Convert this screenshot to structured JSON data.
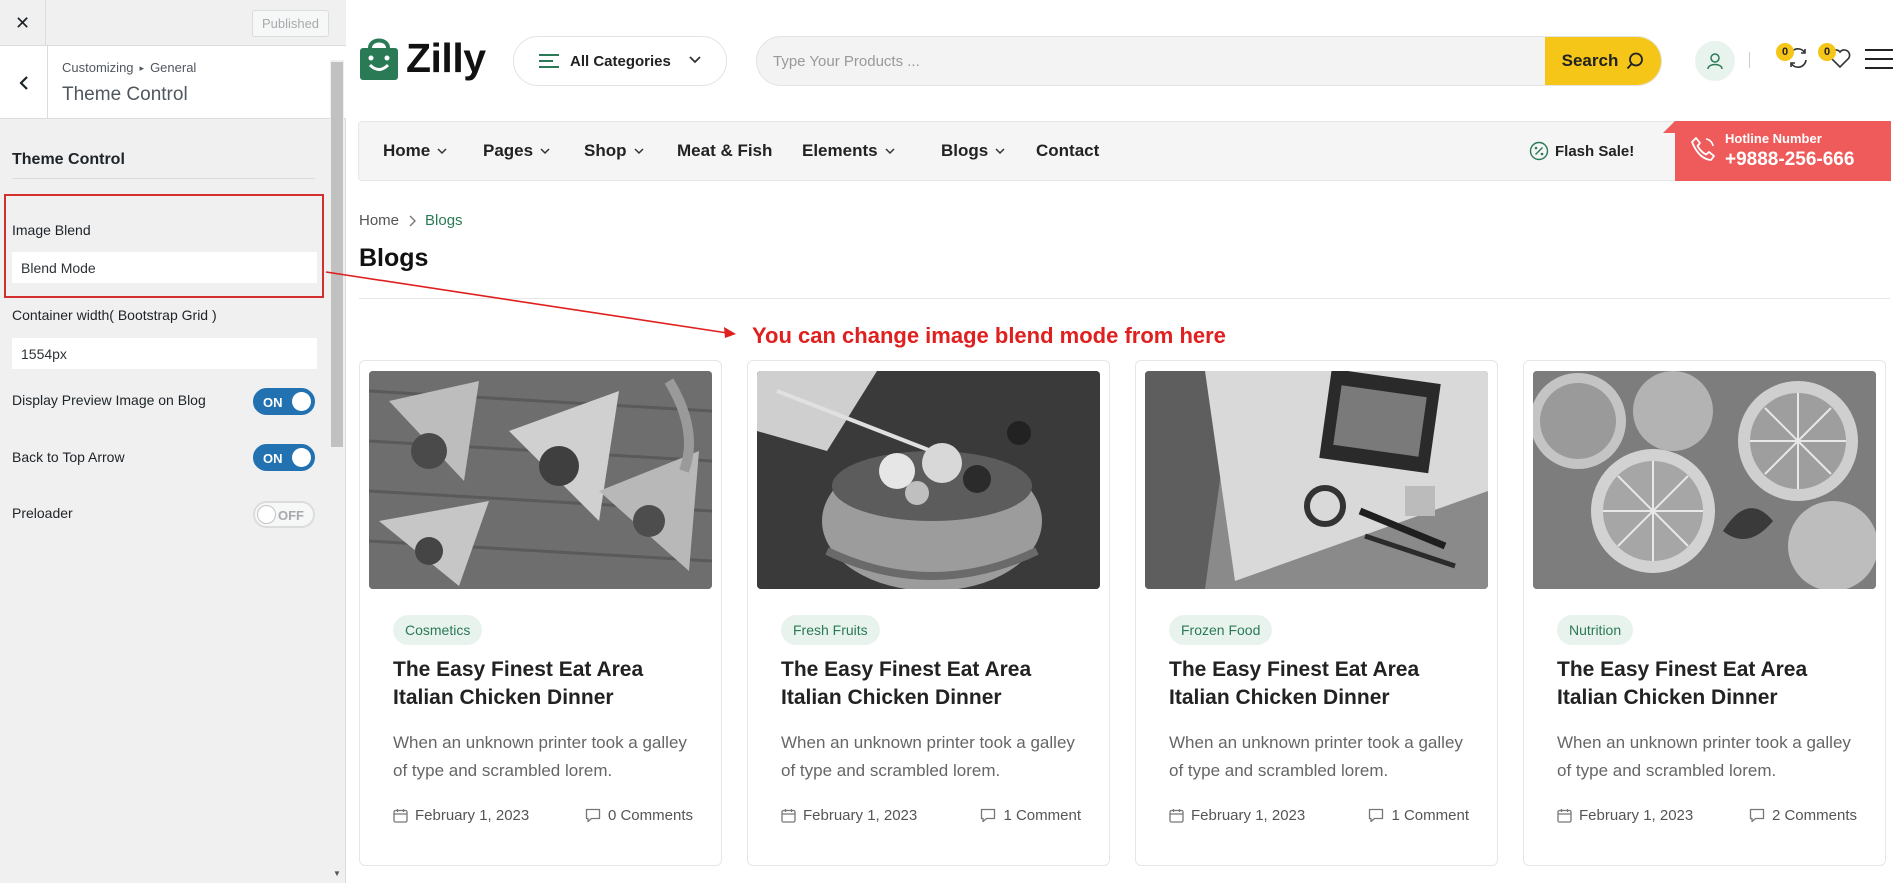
{
  "customizer": {
    "close_icon": "close-icon",
    "published_label": "Published",
    "breadcrumb": [
      "Customizing",
      "General"
    ],
    "panel_title": "Theme Control",
    "section_title": "Theme Control",
    "controls": {
      "image_blend": {
        "label": "Image Blend",
        "value": "Blend Mode"
      },
      "container_width": {
        "label": "Container width( Bootstrap Grid )",
        "value": "1554px"
      },
      "preview_image": {
        "label": "Display Preview Image on Blog",
        "state": "ON"
      },
      "back_to_top": {
        "label": "Back to Top Arrow",
        "state": "ON"
      },
      "preloader": {
        "label": "Preloader",
        "state": "OFF"
      }
    }
  },
  "site": {
    "logo_text": "Zilly",
    "categories_label": "All Categories",
    "search": {
      "placeholder": "Type Your Products ...",
      "button_label": "Search"
    },
    "compare_count": "0",
    "wishlist_count": "0",
    "nav": [
      {
        "label": "Home",
        "dropdown": true
      },
      {
        "label": "Pages",
        "dropdown": true
      },
      {
        "label": "Shop",
        "dropdown": true
      },
      {
        "label": "Meat & Fish",
        "dropdown": false
      },
      {
        "label": "Elements",
        "dropdown": true
      },
      {
        "label": "Blogs",
        "dropdown": true
      },
      {
        "label": "Contact",
        "dropdown": false
      }
    ],
    "flash_sale": "Flash Sale!",
    "hotline": {
      "label": "Hotline Number",
      "number": "+9888-256-666"
    },
    "breadcrumb": {
      "home": "Home",
      "current": "Blogs"
    },
    "page_title": "Blogs",
    "annotation": "You can change image blend mode from here",
    "posts": [
      {
        "tag": "Cosmetics",
        "title": "The Easy Finest Eat Area Italian Chicken Dinner",
        "excerpt": "When an unknown printer took a galley of type and scrambled lorem.",
        "date": "February 1, 2023",
        "comments": "0 Comments"
      },
      {
        "tag": "Fresh Fruits",
        "title": "The Easy Finest Eat Area Italian Chicken Dinner",
        "excerpt": "When an unknown printer took a galley of type and scrambled lorem.",
        "date": "February 1, 2023",
        "comments": "1 Comment"
      },
      {
        "tag": "Frozen Food",
        "title": "The Easy Finest Eat Area Italian Chicken Dinner",
        "excerpt": "When an unknown printer took a galley of type and scrambled lorem.",
        "date": "February 1, 2023",
        "comments": "1 Comment"
      },
      {
        "tag": "Nutrition",
        "title": "The Easy Finest Eat Area Italian Chicken Dinner",
        "excerpt": "When an unknown printer took a galley of type and scrambled lorem.",
        "date": "February 1, 2023",
        "comments": "2 Comments"
      }
    ]
  },
  "colors": {
    "brand_green": "#2a7a56",
    "search_yellow": "#f5c518",
    "hotline_red": "#ef5a5a",
    "toggle_blue": "#2271b1",
    "annotation_red": "#e01f1f"
  }
}
